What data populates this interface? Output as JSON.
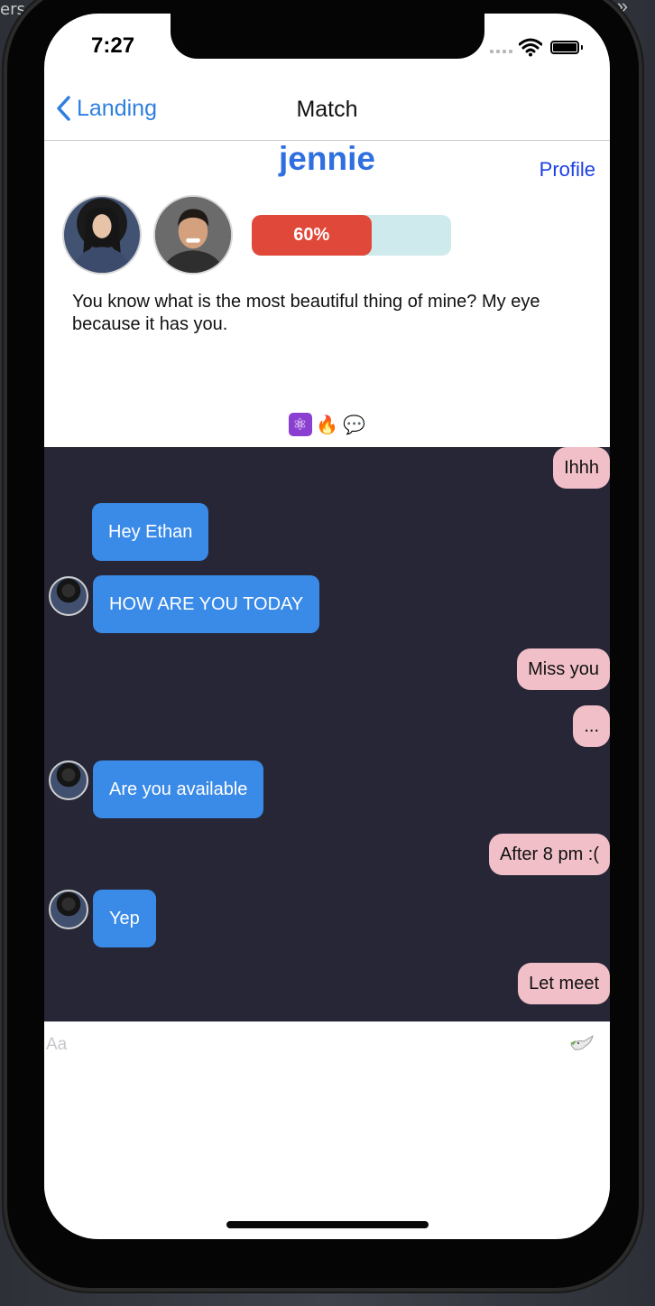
{
  "background": {
    "text": "ers...ti",
    "chevron": "»"
  },
  "status_bar": {
    "time": "7:27"
  },
  "navbar": {
    "back_label": "Landing",
    "title": "Match"
  },
  "match": {
    "name": "jennie",
    "profile_link": "Profile",
    "compatibility": {
      "percent": 60,
      "label": "60%"
    },
    "bio": "You know what is the most beautiful thing of mine? My eye because it has you.",
    "emojis": [
      "⚛",
      "🔥",
      "💬"
    ]
  },
  "messages": [
    {
      "from": "me",
      "text": "Ihhh"
    },
    {
      "from": "them",
      "text": "Hey Ethan",
      "avatar": false
    },
    {
      "from": "them",
      "text": "HOW ARE YOU TODAY",
      "avatar": true
    },
    {
      "from": "me",
      "text": "Miss you"
    },
    {
      "from": "me",
      "text": "..."
    },
    {
      "from": "them",
      "text": "Are you available",
      "avatar": true
    },
    {
      "from": "me",
      "text": "After 8 pm :("
    },
    {
      "from": "them",
      "text": "Yep",
      "avatar": true
    },
    {
      "from": "me",
      "text": "Let meet"
    }
  ],
  "composer": {
    "placeholder": "Aa",
    "value": ""
  },
  "colors": {
    "accent": "#2f7fe0",
    "progress_fill": "#e0483a",
    "progress_track": "#cfeaec",
    "chat_bg": "#262636",
    "bubble_me": "#f1bfc7",
    "bubble_them": "#3a8ae8"
  },
  "icons": {
    "back": "chevron-left-icon",
    "send": "dove-icon",
    "wifi": "wifi-icon",
    "battery": "battery-icon"
  }
}
